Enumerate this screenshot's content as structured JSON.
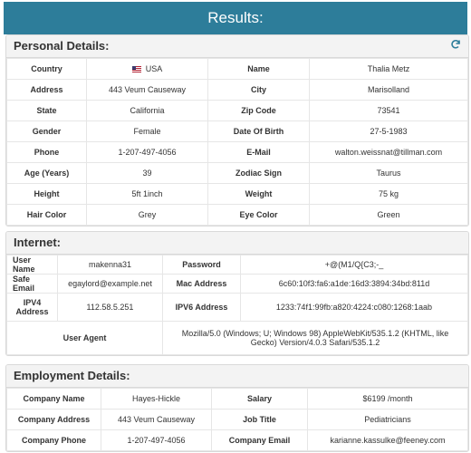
{
  "results_title": "Results:",
  "personal": {
    "title": "Personal Details:",
    "refresh_icon": "refresh-icon",
    "rows": [
      {
        "k1": "Country",
        "v1": "USA",
        "k2": "Name",
        "v2": "Thalia Metz"
      },
      {
        "k1": "Address",
        "v1": "443 Veum Causeway",
        "k2": "City",
        "v2": "Marisolland"
      },
      {
        "k1": "State",
        "v1": "California",
        "k2": "Zip Code",
        "v2": "73541"
      },
      {
        "k1": "Gender",
        "v1": "Female",
        "k2": "Date Of Birth",
        "v2": "27-5-1983"
      },
      {
        "k1": "Phone",
        "v1": "1-207-497-4056",
        "k2": "E-Mail",
        "v2": "walton.weissnat@tillman.com"
      },
      {
        "k1": "Age (Years)",
        "v1": "39",
        "k2": "Zodiac Sign",
        "v2": "Taurus"
      },
      {
        "k1": "Height",
        "v1": "5ft 1inch",
        "k2": "Weight",
        "v2": "75 kg"
      },
      {
        "k1": "Hair Color",
        "v1": "Grey",
        "k2": "Eye Color",
        "v2": "Green"
      }
    ]
  },
  "internet": {
    "title": "Internet:",
    "username_label": "User Name",
    "username": "makenna31",
    "password_label": "Password",
    "password": "+@(M1/Q{C3;-_",
    "safe_email_label": "Safe Email",
    "safe_email": "egaylord@example.net",
    "mac_label": "Mac Address",
    "mac": "6c60:10f3:fa6:a1de:16d3:3894:34bd:811d",
    "ipv4_label": "IPV4 Address",
    "ipv4": "112.58.5.251",
    "ipv6_label": "IPV6 Address",
    "ipv6": "1233:74f1:99fb:a820:4224:c080:1268:1aab",
    "ua_label": "User Agent",
    "ua": "Mozilla/5.0 (Windows; U; Windows 98) AppleWebKit/535.1.2 (KHTML, like Gecko) Version/4.0.3 Safari/535.1.2"
  },
  "employment": {
    "title": "Employment Details:",
    "rows": [
      {
        "k1": "Company Name",
        "v1": "Hayes-Hickle",
        "k2": "Salary",
        "v2": "$6199 /month"
      },
      {
        "k1": "Company Address",
        "v1": "443 Veum Causeway",
        "k2": "Job Title",
        "v2": "Pediatricians"
      },
      {
        "k1": "Company Phone",
        "v1": "1-207-497-4056",
        "k2": "Company Email",
        "v2": "karianne.kassulke@feeney.com"
      }
    ]
  }
}
